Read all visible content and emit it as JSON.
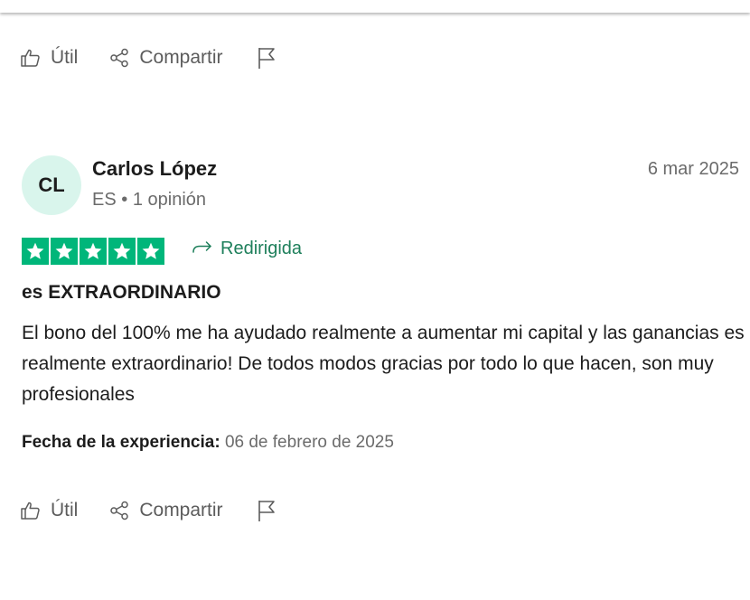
{
  "colors": {
    "star_green": "#00b67a",
    "accent_green": "#1e7f5b",
    "avatar_bg": "#d9f5ec",
    "muted_text": "#6b6b6b"
  },
  "prev_actions": {
    "useful_label": "Útil",
    "share_label": "Compartir",
    "flag_icon": "flag-icon"
  },
  "review": {
    "avatar_initials": "CL",
    "reviewer_name": "Carlos López",
    "country": "ES",
    "separator": "•",
    "review_count": "1 opinión",
    "date": "6 mar 2025",
    "rating": 5,
    "rating_max": 5,
    "redirect_label": "Redirigida",
    "title": "es EXTRAORDINARIO",
    "body": "El bono del 100% me ha ayudado realmente a aumentar mi capital y las ganancias es realmente extraordinario! De todos modos gracias por todo lo que hacen, son muy profesionales",
    "experience_label": "Fecha de la experiencia:",
    "experience_date": "06 de febrero de 2025"
  },
  "actions": {
    "useful_label": "Útil",
    "share_label": "Compartir",
    "flag_icon": "flag-icon"
  }
}
